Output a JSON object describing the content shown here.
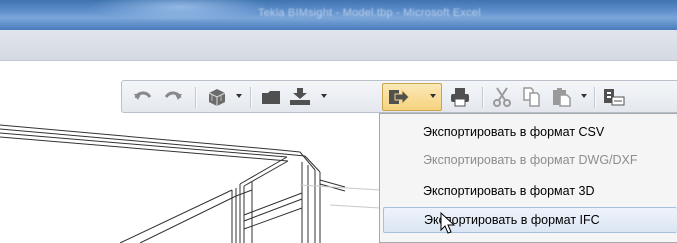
{
  "window": {
    "title": "Tekla BIMsight - Model.tbp - Microsoft Excel"
  },
  "toolbar": {
    "buttons": [
      {
        "name": "undo-icon"
      },
      {
        "name": "redo-icon"
      },
      {
        "name": "3d-view-icon"
      },
      {
        "name": "open-folder-icon"
      },
      {
        "name": "import-icon"
      },
      {
        "name": "export-icon"
      },
      {
        "name": "print-icon"
      },
      {
        "name": "cut-icon"
      },
      {
        "name": "copy-icon"
      },
      {
        "name": "paste-icon"
      },
      {
        "name": "special-icon"
      }
    ],
    "active_button": "export"
  },
  "export_menu": {
    "items": [
      {
        "label": "Экспортировать в формат CSV",
        "enabled": true
      },
      {
        "label": "Экспортировать в формат DWG/DXF",
        "enabled": false
      },
      {
        "label": "Экспортировать в формат 3D",
        "enabled": true
      },
      {
        "label": "Экспортировать в формат IFC",
        "enabled": true,
        "hovered": true
      }
    ]
  },
  "colors": {
    "titlebar": "#4a7bbb",
    "menu_hover": "#dbe6f4",
    "toolbar_active": "#f6d27e"
  }
}
